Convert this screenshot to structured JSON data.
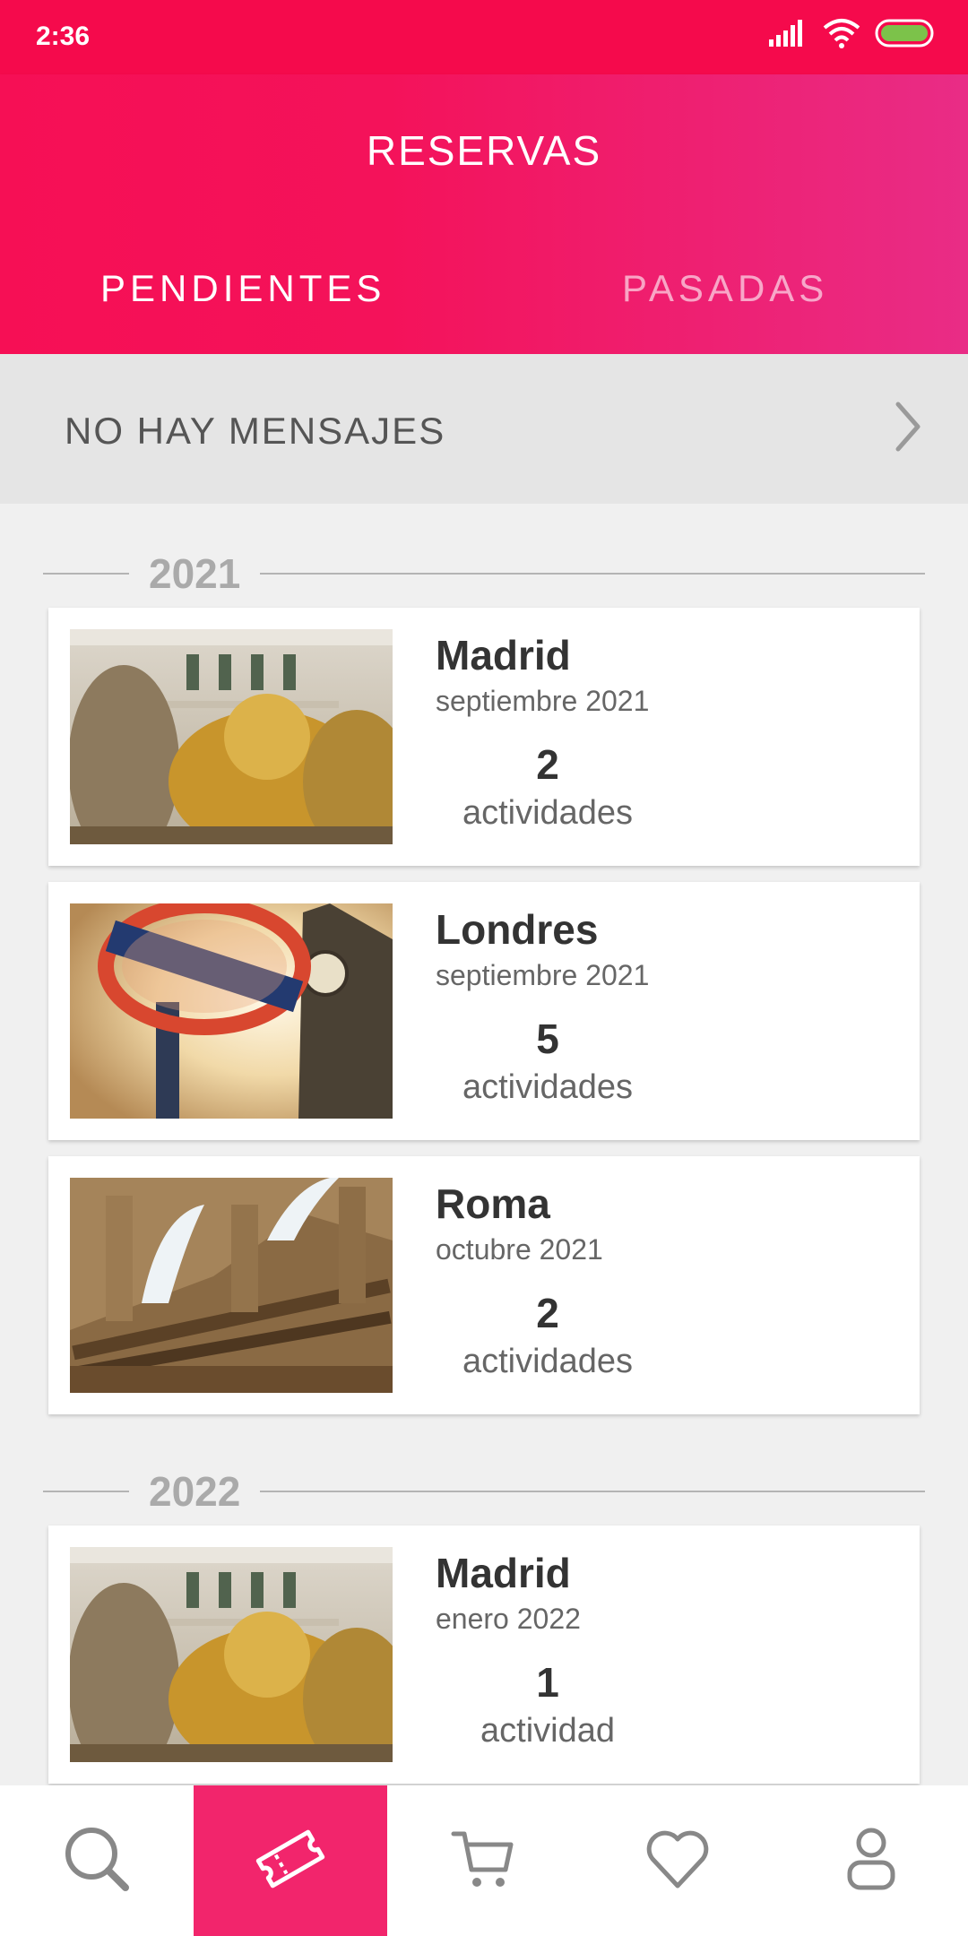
{
  "status_bar": {
    "time": "2:36"
  },
  "header": {
    "title": "RESERVAS"
  },
  "tabs": [
    {
      "label": "PENDIENTES",
      "active": true
    },
    {
      "label": "PASADAS",
      "active": false
    }
  ],
  "messages": {
    "label": "NO HAY MENSAJES"
  },
  "groups": [
    {
      "year": "2021",
      "bookings": [
        {
          "city": "Madrid",
          "date": "septiembre 2021",
          "count": "2",
          "unit": "actividades",
          "image": "madrid-cibeles-photo"
        },
        {
          "city": "Londres",
          "date": "septiembre 2021",
          "count": "5",
          "unit": "actividades",
          "image": "london-underground-big-ben-photo"
        },
        {
          "city": "Roma",
          "date": "octubre 2021",
          "count": "2",
          "unit": "actividades",
          "image": "rome-colosseum-photo"
        }
      ]
    },
    {
      "year": "2022",
      "bookings": [
        {
          "city": "Madrid",
          "date": "enero 2022",
          "count": "1",
          "unit": "actividad",
          "image": "madrid-cibeles-photo"
        }
      ]
    }
  ],
  "bottom_nav": [
    {
      "icon": "search-icon",
      "active": false
    },
    {
      "icon": "ticket-icon",
      "active": true
    },
    {
      "icon": "cart-icon",
      "active": false
    },
    {
      "icon": "heart-icon",
      "active": false
    },
    {
      "icon": "user-icon",
      "active": false
    }
  ],
  "colors": {
    "accent": "#f2256c",
    "status_bar": "#f50a4c",
    "battery": "#7cc24a"
  }
}
